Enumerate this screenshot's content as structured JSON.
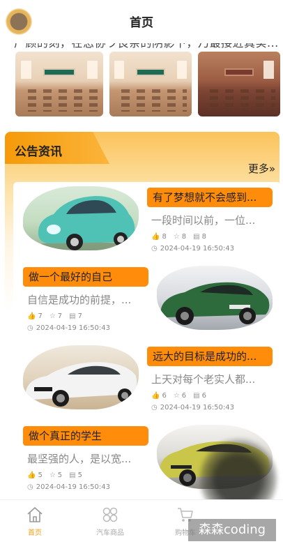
{
  "header": {
    "title": "首页"
  },
  "ticker": {
    "text": "广顾的刻，在恋协ラ良亲的阴影下，乃最接近真实..."
  },
  "gallery": {
    "images": [
      "classroom-1",
      "classroom-2",
      "classroom-3"
    ]
  },
  "notices": {
    "title": "公告资讯",
    "more_label": "更多»",
    "items": [
      {
        "title": "有了梦想就不会感到...",
        "desc": "一段时间以前，一位...",
        "likes": "8",
        "favorites": "8",
        "views": "8",
        "time": "2024-04-19 16:50:43"
      },
      {
        "title": "做一个最好的自己",
        "desc": "自信是成功的前提，...",
        "likes": "7",
        "favorites": "7",
        "views": "7",
        "time": "2024-04-19 16:50:43"
      },
      {
        "title": "远大的目标是成功的...",
        "desc": "上天对每个老实人都...",
        "likes": "6",
        "favorites": "6",
        "views": "6",
        "time": "2024-04-19 16:50:43"
      },
      {
        "title": "做个真正的学生",
        "desc": "最坚强的人，是以宽...",
        "likes": "5",
        "favorites": "5",
        "views": "5",
        "time": "2024-04-19 16:50:43"
      }
    ]
  },
  "tabbar": {
    "items": [
      {
        "label": "首页",
        "icon": "home-icon",
        "active": true
      },
      {
        "label": "汽车商品",
        "icon": "grid-icon",
        "active": false
      },
      {
        "label": "购物车",
        "icon": "cart-icon",
        "active": false
      }
    ]
  },
  "watermark": {
    "text": "森森coding"
  },
  "colors": {
    "accent": "#ff8c0a",
    "tab_active": "#f0a01a"
  }
}
